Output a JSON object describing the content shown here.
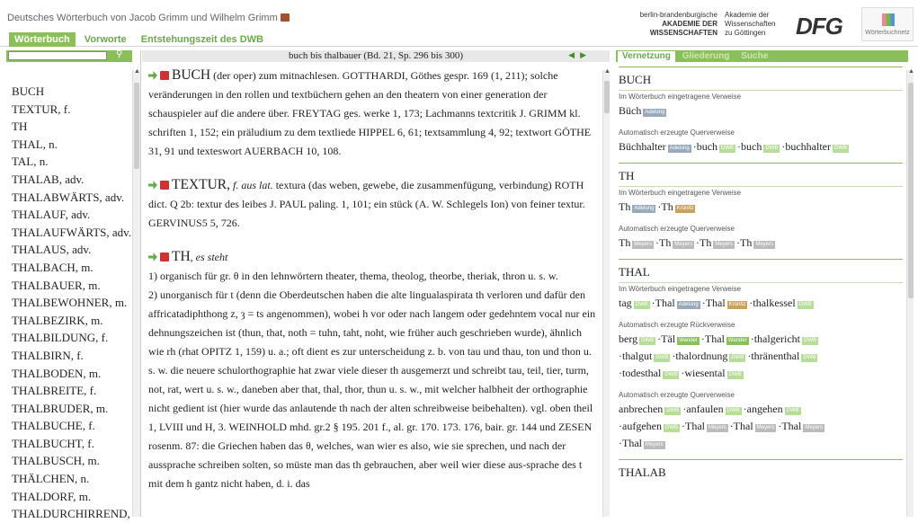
{
  "header": {
    "title": "Deutsches Wörterbuch von Jacob Grimm und Wilhelm Grimm",
    "tabs": [
      {
        "label": "Wörterbuch",
        "active": true
      },
      {
        "label": "Vorworte",
        "active": false
      },
      {
        "label": "Entstehungszeit des DWB",
        "active": false
      }
    ],
    "logos": {
      "bbaw_line1": "berlin-brandenburgische",
      "bbaw_line2": "AKADEMIE DER WISSENSCHAFTEN",
      "gott_line1": "Akademie der Wissenschaften",
      "gott_line2": "zu Göttingen",
      "dfg": "DFG",
      "wn": "Wörterbuchnetz"
    }
  },
  "search": {
    "value": "",
    "placeholder": ""
  },
  "lemmas": [
    "BUCH",
    "TEXTUR, f.",
    "TH",
    "THAL, n.",
    "TAL, n.",
    "THALAB, adv.",
    "THALABWÄRTS, adv.",
    "THALAUF, adv.",
    "THALAUFWÄRTS, adv.",
    "THALAUS, adv.",
    "THALBACH, m.",
    "THALBAUER, m.",
    "THALBEWOHNER, m.",
    "THALBEZIRK, m.",
    "THALBILDUNG, f.",
    "THALBIRN, f.",
    "THALBODEN, m.",
    "THALBREITE, f.",
    "THALBRUDER, m.",
    "THALBUCHE, f.",
    "THALBUCHT, f.",
    "THALBUSCH, m.",
    "THÄLCHEN, n.",
    "THALDORF, m.",
    "THALDURCHIRREND,"
  ],
  "article_header": "buch bis thalbauer (Bd. 21, Sp. 296 bis 300)",
  "entries": {
    "buch": {
      "lemma": "BUCH",
      "text": "(der oper) zum mitnachlesen. GOTTHARDI, Göthes gespr. 169 (1, 211); solche veränderungen in den rollen und textbüchern gehen an den theatern von einer generation der schauspieler auf die andere über. FREYTAG ges. werke 1, 173; Lachmanns textcritik J. GRIMM kl. schriften 1, 152; ein präludium zu dem textliede HIPPEL 6, 61; textsammlung 4, 92; textwort GÖTHE 31, 91 und texteswort AUERBACH 10, 108."
    },
    "textur": {
      "lemma": "TEXTUR,",
      "gram": "f. aus lat.",
      "text": "textura (das weben, gewebe, die zusammenfügung, verbindung) ROTH dict. Q 2b: textur des leibes J. PAUL paling. 1, 101; ein stück (A. W. Schlegels Ion) von feiner textur. GERVINUS5 5, 726."
    },
    "th": {
      "lemma": "TH",
      "gram": ", es steht",
      "p1": "1) organisch für gr. θ in den lehnwörtern theater, thema, theolog, theorbe, theriak, thron u. s. w.",
      "p2": "2) unorganisch für t (denn die Oberdeutschen haben die alte lingualaspirata th verloren und dafür den affricatadiphthong z, ȝ = ts angenommen), wobei h vor oder nach langem oder gedehntem vocal nur ein dehnungszeichen ist (thun, that, noth = tuhn, taht, noht, wie früher auch geschrieben wurde), ähnlich wie rh (rhat OPITZ 1, 159) u. a.; oft dient es zur unterscheidung z. b. von tau und thau, ton und thon u. s. w. die neuere schulorthographie hat zwar viele dieser th ausgemerzt und schreibt tau, teil, tier, turm, not, rat, wert u. s. w., daneben aber that, thal, thor, thun u. s. w., mit welcher halbheit der orthographie nicht gedient ist (hier wurde das anlautende th nach der alten schreibweise beibehalten). vgl. oben theil 1, LVIII und H, 3. WEINHOLD mhd. gr.2 § 195. 201 f., al. gr. 170. 173. 176, bair. gr. 144 und ZESEN rosenm. 87: die Griechen haben das θ, welches, wan wier es also, wie sie sprechen, und nach der aussprache schreiben solten, so müste man das th gebrauchen, aber weil wier diese aus-sprache des t mit dem h gantz nicht haben, d. i. das"
    }
  },
  "right_tabs": [
    {
      "label": "Vernetzung",
      "active": true
    },
    {
      "label": "Gliederung",
      "active": false
    },
    {
      "label": "Suche",
      "active": false
    }
  ],
  "labels": {
    "eingetragen": "Im Wörterbuch eingetragene Verweise",
    "quer": "Automatisch erzeugte Querverweise",
    "rueck": "Automatisch erzeugte Rückverweise"
  },
  "tags": {
    "adelung": "Adelung",
    "dwb": "DWB",
    "kraenitz": "Krünitz",
    "meyers": "Meyers",
    "wander": "Wander"
  },
  "refs": {
    "buch": {
      "head": "BUCH",
      "e": [
        "Büch"
      ],
      "q": [
        "Büchhalter",
        "buch",
        "buch",
        "buchhalter"
      ]
    },
    "th": {
      "head": "TH",
      "e": [
        "Th",
        "Th"
      ],
      "q": [
        "Th",
        "Th",
        "Th",
        "Th"
      ]
    },
    "thal": {
      "head": "THAL",
      "e": [
        "tag",
        "Thal",
        "Thal",
        "thalkessel"
      ],
      "r1": [
        "berg",
        "Täl",
        "Thal",
        "thalgericht"
      ],
      "r2": [
        "thalgut",
        "thalordnung",
        "thränenthal"
      ],
      "r3": [
        "todesthal",
        "wiesental"
      ],
      "q1": [
        "anbrechen",
        "anfaulen",
        "angehen"
      ],
      "q2": [
        "aufgehen",
        "Thal",
        "Thal",
        "Thal"
      ],
      "q3": [
        "Thal"
      ]
    },
    "thalab": {
      "head": "THALAB"
    }
  },
  "colors": {
    "accent": "#8bbf5a",
    "tag_dwb": "#b8dc9a",
    "tag_adelung": "#9ab",
    "tag_meyers": "#bbb",
    "tag_kraenitz": "#c9a35a"
  },
  "icons": [
    "book-icon",
    "search-icon",
    "arrow-right-icon",
    "pdf-icon",
    "chevron-left-icon",
    "chevron-right-icon"
  ]
}
